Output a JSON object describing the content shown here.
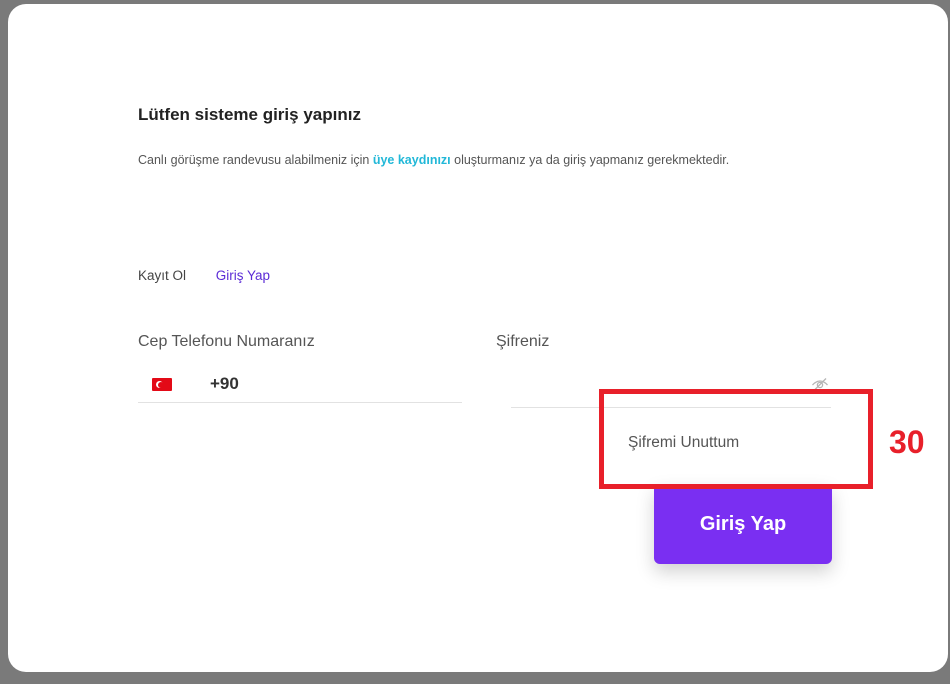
{
  "heading": "Lütfen sisteme giriş yapınız",
  "intro": {
    "before": "Canlı görüşme randevusu alabilmeniz için ",
    "link": "üye kaydınızı",
    "after": " oluşturmanız ya da giriş yapmanız gerekmektedir."
  },
  "tabs": {
    "register": "Kayıt Ol",
    "login": "Giriş Yap"
  },
  "phone": {
    "label": "Cep Telefonu Numaranız",
    "dial_code": "+90",
    "value": "",
    "country_icon": "turkey-flag-icon"
  },
  "password": {
    "label": "Şifreniz",
    "value": "",
    "toggle_icon": "eye-slash-icon"
  },
  "forgot_password": "Şifremi Unuttum",
  "login_button": "Giriş Yap",
  "annotation": {
    "step": "30"
  },
  "colors": {
    "accent": "#7a2ff2",
    "link": "#22b8d8",
    "active_tab": "#5b2bd6",
    "annotation": "#e8202a"
  }
}
